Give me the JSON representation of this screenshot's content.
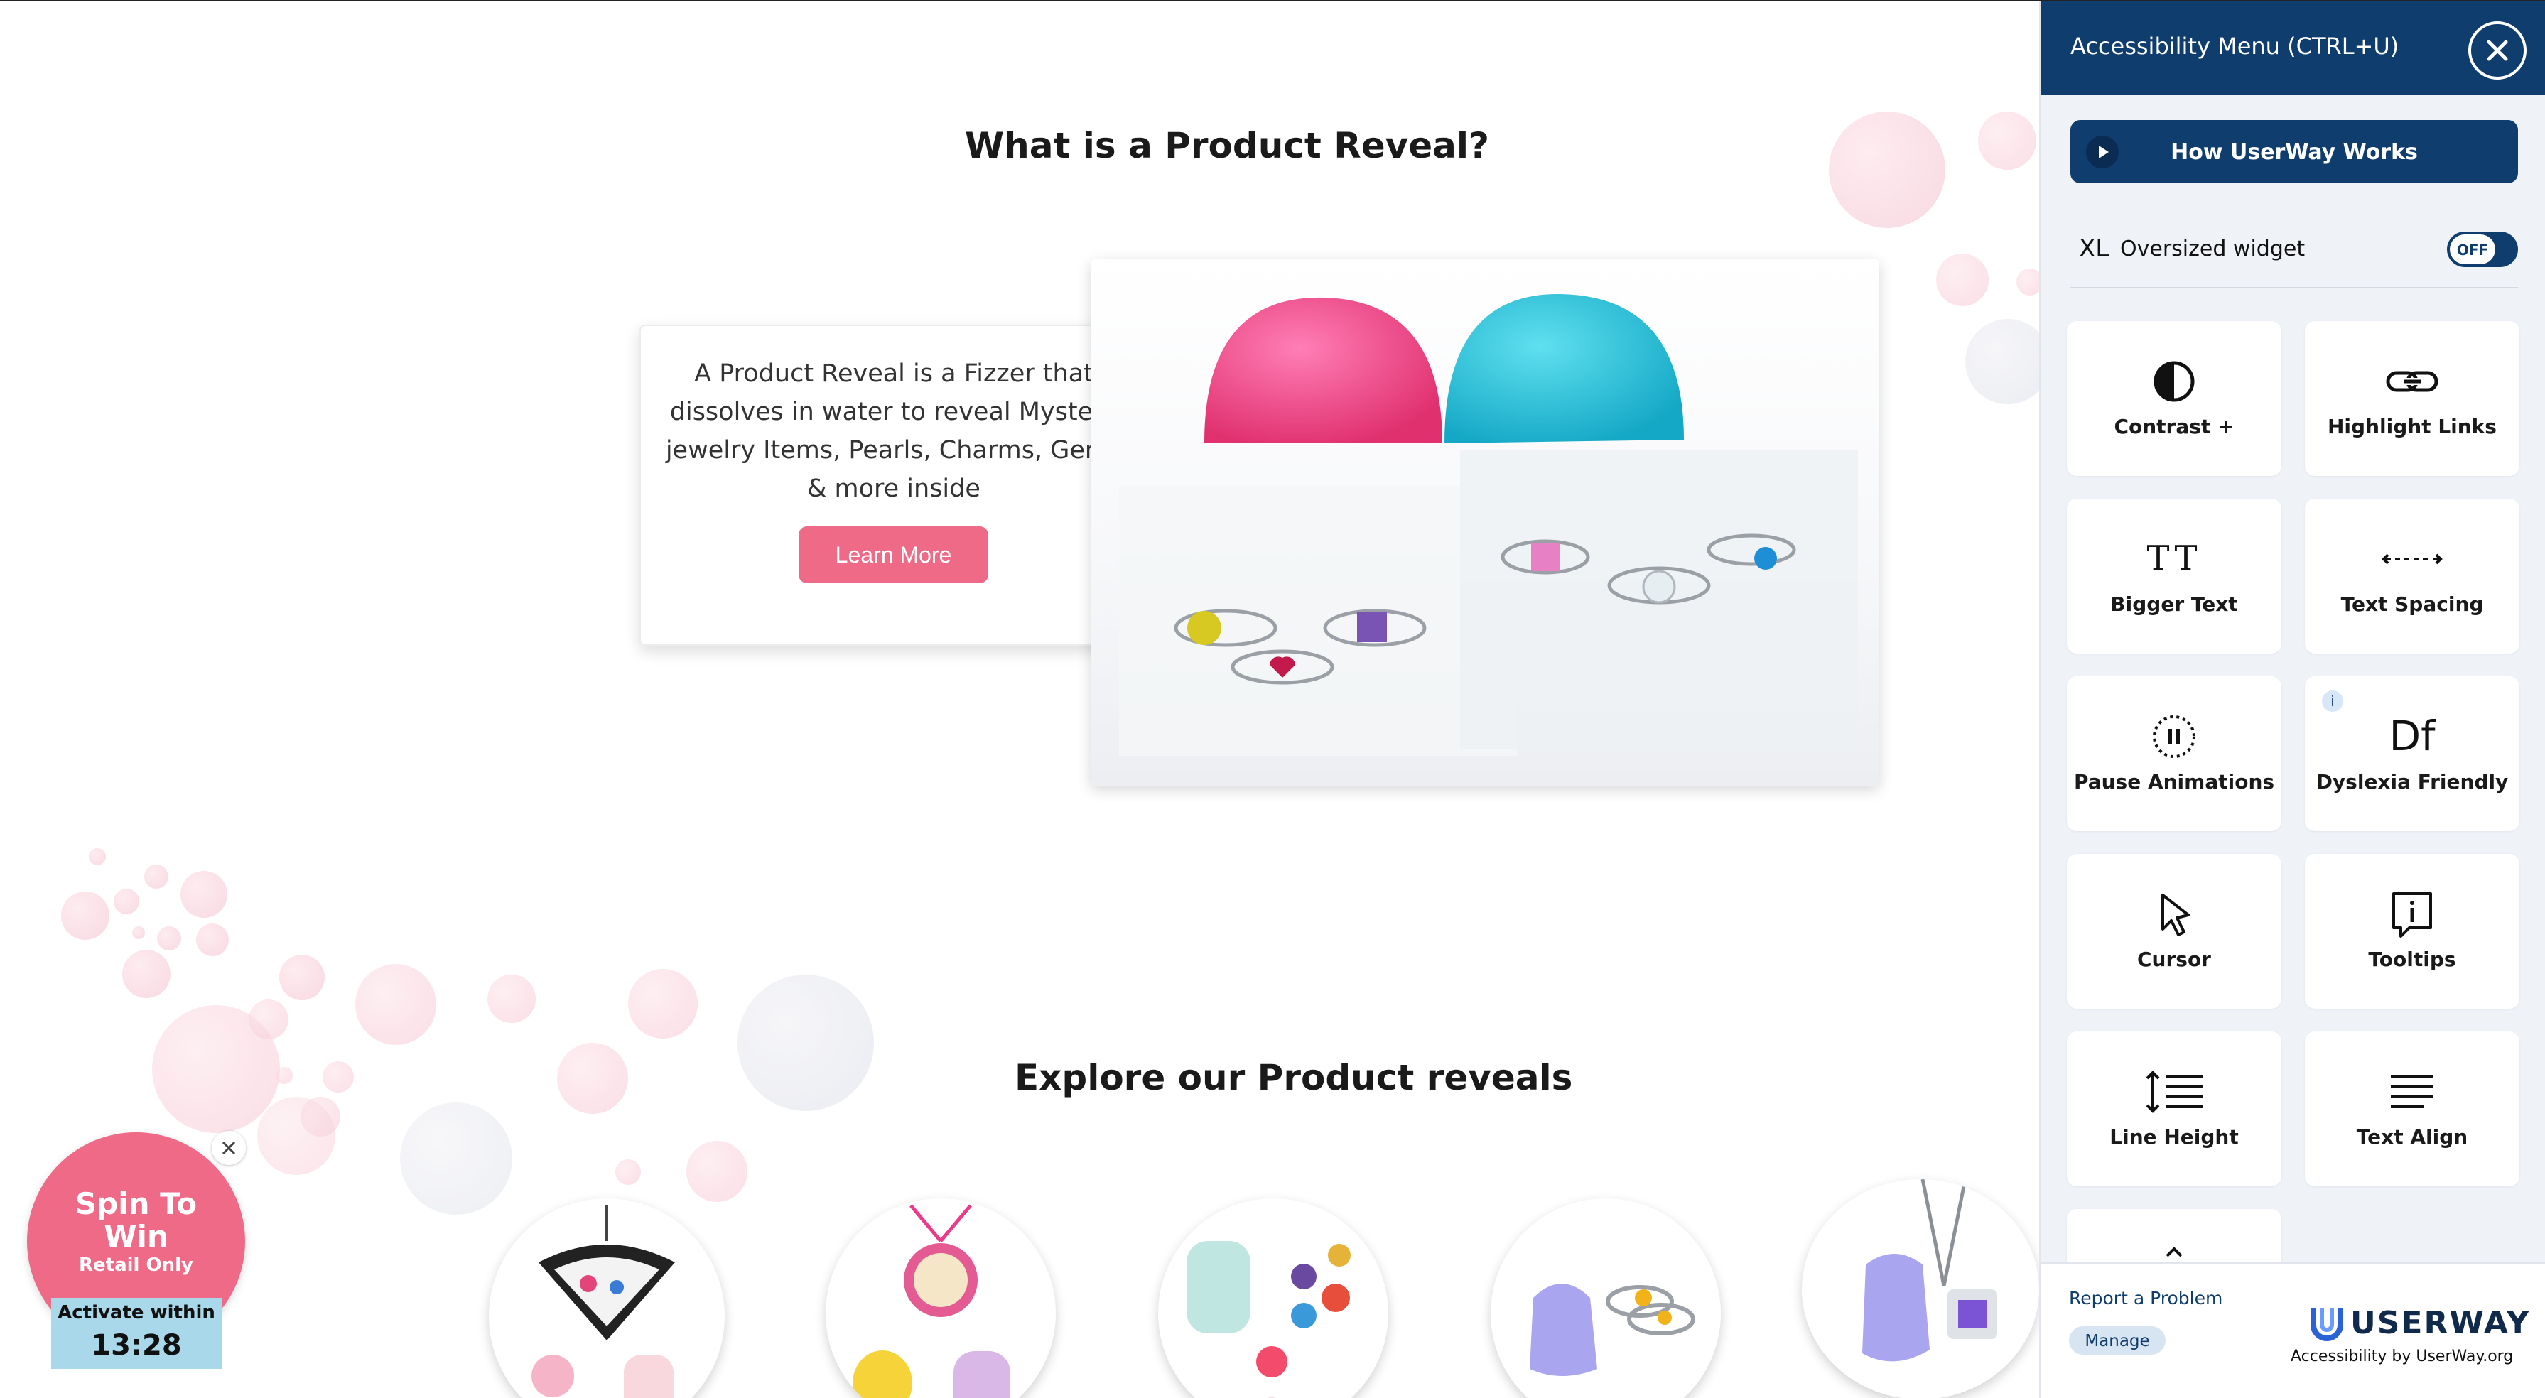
{
  "main": {
    "heading": "What is a Product Reveal?",
    "info": {
      "text": "A Product Reveal is a Fizzer that dissolves in water to reveal Mystery jewelry Items, Pearls, Charms, Gems & more inside",
      "button": "Learn More"
    },
    "explore_heading": "Explore our Product reveals"
  },
  "colors": {
    "accent_pink": "#ee6a86",
    "panel_navy": "#0f3d6e",
    "spin_blue": "#a8d8ea"
  },
  "spin_widget": {
    "line1": "Spin To",
    "line2": "Win",
    "subtitle": "Retail Only",
    "activate_label": "Activate within",
    "timer": "13:28"
  },
  "accessibility": {
    "title": "Accessibility Menu (CTRL+U)",
    "how_button": "How UserWay Works",
    "xl_badge": "XL",
    "oversized_label": "Oversized widget",
    "toggle_state": "OFF",
    "tiles": [
      {
        "label": "Contrast +",
        "icon": "contrast-icon"
      },
      {
        "label": "Highlight Links",
        "icon": "link-icon"
      },
      {
        "label": "Bigger Text",
        "icon": "text-size-icon"
      },
      {
        "label": "Text Spacing",
        "icon": "text-spacing-icon"
      },
      {
        "label": "Pause Animations",
        "icon": "pause-icon"
      },
      {
        "label": "Dyslexia Friendly",
        "icon": "dyslexia-icon"
      },
      {
        "label": "Cursor",
        "icon": "cursor-icon"
      },
      {
        "label": "Tooltips",
        "icon": "tooltip-icon"
      },
      {
        "label": "Line Height",
        "icon": "line-height-icon"
      },
      {
        "label": "Text Align",
        "icon": "text-align-icon"
      }
    ],
    "dyslexia_glyph": "Df",
    "bigger_text_glyph": "TT",
    "info_badge": "i",
    "report_link": "Report a Problem",
    "manage_button": "Manage",
    "brand": "USERWAY",
    "brand_sub": "Accessibility by UserWay.org"
  }
}
